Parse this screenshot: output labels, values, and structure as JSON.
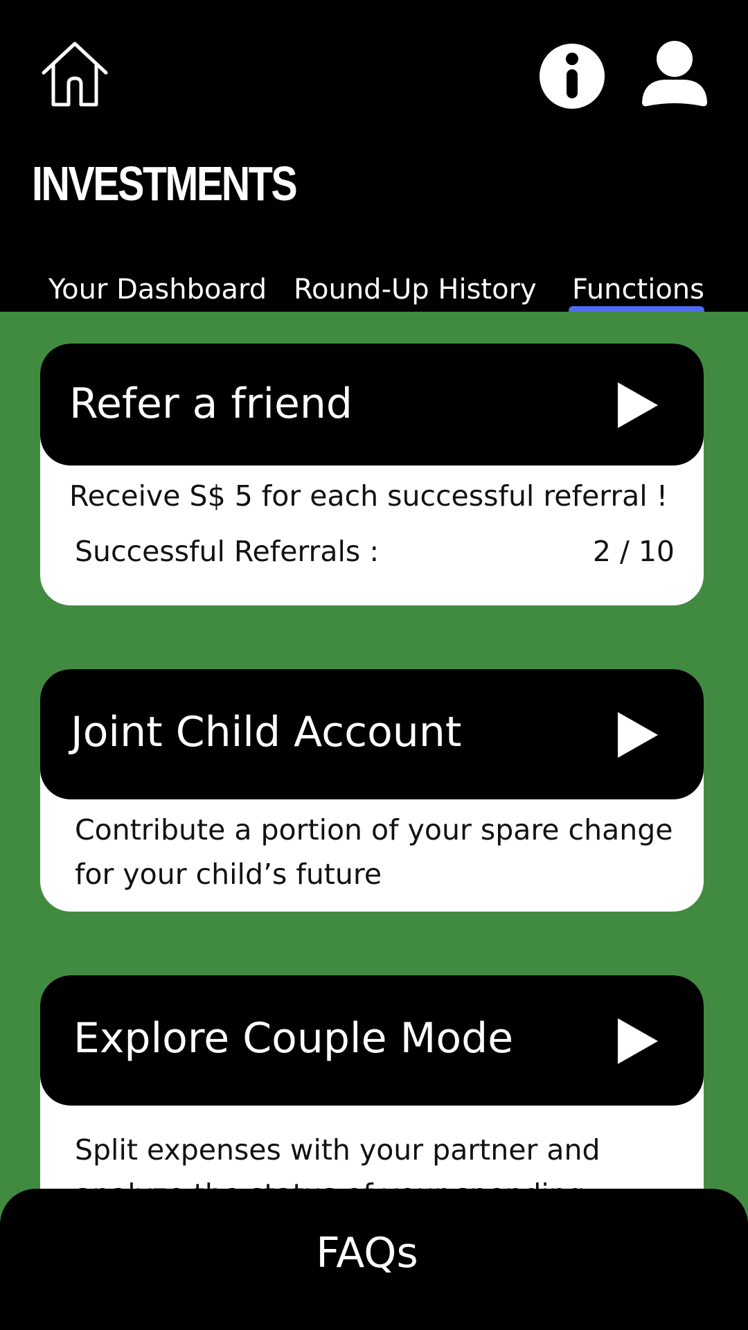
{
  "header": {
    "title": "INVESTMENTS",
    "icons": [
      "home-icon",
      "info-icon",
      "user-icon"
    ]
  },
  "tabs": [
    {
      "label": "Your Dashboard",
      "active": false
    },
    {
      "label": "Round-Up History",
      "active": false
    },
    {
      "label": "Functions",
      "active": true
    }
  ],
  "cards": [
    {
      "title": "Refer a friend",
      "description": "Receive S$ 5 for each successful referral !",
      "referrals_label": "Successful Referrals :",
      "referrals_value": "2 / 10"
    },
    {
      "title": "Joint Child Account",
      "description": "Contribute a portion of your spare change for your child’s future"
    },
    {
      "title": "Explore Couple Mode",
      "description": "Split expenses with your partner and analyze the status of your spending"
    }
  ],
  "footer": {
    "faq_label": "FAQs"
  },
  "colors": {
    "header_bg": "#000000",
    "content_bg": "#418b41",
    "card_bg": "#ffffff",
    "tab_underline": "#4f6bf0"
  }
}
